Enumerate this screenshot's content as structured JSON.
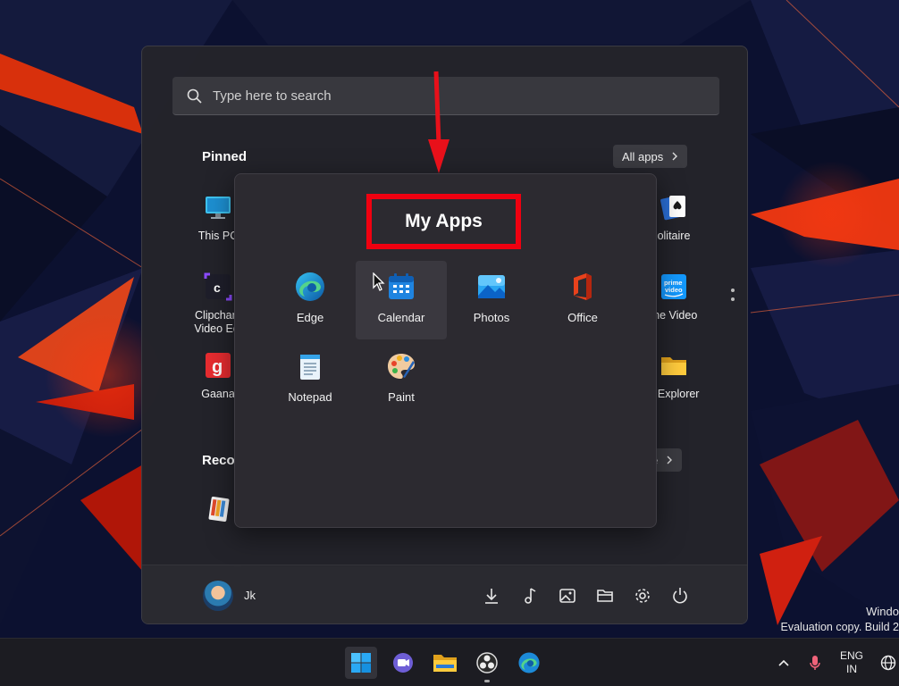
{
  "search": {
    "placeholder": "Type here to search"
  },
  "pinned": {
    "title": "Pinned",
    "all_apps_label": "All apps"
  },
  "pinned_visible": {
    "this_pc": "This PC",
    "solitaire": "olitaire",
    "clipchamp_line1": "Clipcham",
    "clipchamp_line2": "Video Edi",
    "prime_video": "me Video",
    "gaana": "Gaana",
    "file_explorer": "e Explorer"
  },
  "recommended": {
    "title": "Reco",
    "more_label": "e"
  },
  "folder": {
    "title": "My Apps",
    "apps": [
      "Edge",
      "Calendar",
      "Photos",
      "Office",
      "Notepad",
      "Paint"
    ]
  },
  "user": {
    "name": "Jk"
  },
  "watermark": {
    "line1": "Windo",
    "line2": "Evaluation copy. Build 2"
  },
  "tray": {
    "lang_line1": "ENG",
    "lang_line2": "IN"
  },
  "icons": {
    "footer": [
      "download-icon",
      "music-icon",
      "pictures-icon",
      "folder-icon",
      "settings-icon",
      "power-icon"
    ],
    "taskbar": [
      "start-icon",
      "teams-chat-icon",
      "file-explorer-icon",
      "obs-icon",
      "edge-icon"
    ]
  },
  "colors": {
    "highlight_box": "#f00010",
    "arrow": "#e8101a",
    "accent": "#0a84d6"
  }
}
